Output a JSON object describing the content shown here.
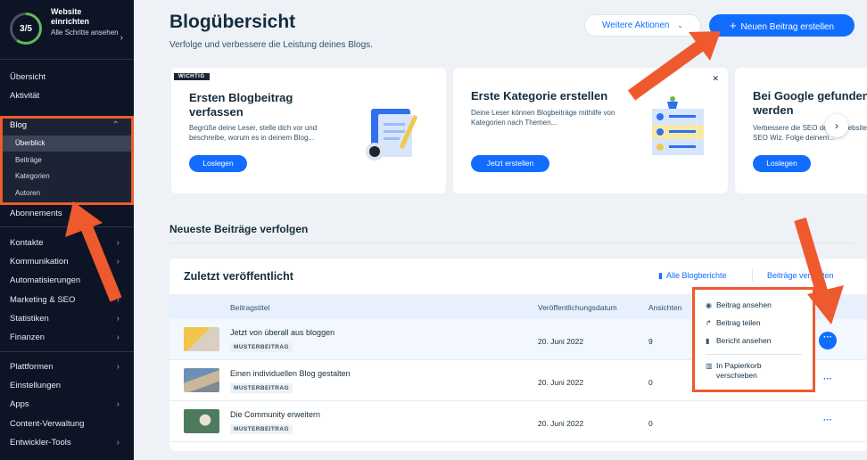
{
  "sidebar": {
    "setup": {
      "progress_label": "3/5",
      "progress": 0.6,
      "title": "Website einrichten",
      "subtitle": "Alle Schritte ansehen"
    },
    "items_top": [
      "Übersicht",
      "Aktivität"
    ],
    "blog": {
      "label": "Blog",
      "sub": [
        "Überblick",
        "Beiträge",
        "Kategorien",
        "Autoren"
      ],
      "active": "Überblick"
    },
    "items_mid": [
      "Abonnements",
      "Kontakte",
      "Kommunikation",
      "Automatisierungen",
      "Marketing & SEO",
      "Statistiken",
      "Finanzen"
    ],
    "items_bottom": [
      "Plattformen",
      "Einstellungen",
      "Apps",
      "Content-Verwaltung",
      "Entwickler-Tools"
    ]
  },
  "header": {
    "title": "Blogübersicht",
    "subtitle": "Verfolge und verbessere die Leistung deines Blogs.",
    "more_actions": "Weitere Aktionen",
    "new_post": "Neuen Beitrag erstellen"
  },
  "cards": [
    {
      "badge": "WICHTIG",
      "title": "Ersten Blogbeitrag verfassen",
      "text": "Begrüße deine Leser, stelle dich vor und beschreibe, worum es in deinem Blog...",
      "button": "Loslegen"
    },
    {
      "title": "Erste Kategorie erstellen",
      "text": "Deine Leser können Blogbeiträge mithilfe von Kategorien nach Themen...",
      "button": "Jetzt erstellen"
    },
    {
      "title": "Bei Google gefunden werden",
      "text": "Verbessere die SEO deiner Website mit dem SEO Wiz. Folge deinem...",
      "button": "Loslegen"
    }
  ],
  "section_title": "Neueste Beiträge verfolgen",
  "panel": {
    "title": "Zuletzt veröffentlicht",
    "link_all": "Alle Blogberichte",
    "link_manage": "Beiträge verwalten",
    "columns": [
      "Beitragstitel",
      "Veröffentlichungsdatum",
      "Ansichten"
    ],
    "rows": [
      {
        "title": "Jetzt von überall aus bloggen",
        "badge": "MUSTERBEITRAG",
        "date": "20. Juni 2022",
        "views": "9"
      },
      {
        "title": "Einen individuellen Blog gestalten",
        "badge": "MUSTERBEITRAG",
        "date": "20. Juni 2022",
        "views": "0"
      },
      {
        "title": "Die Community erweitern",
        "badge": "MUSTERBEITRAG",
        "date": "20. Juni 2022",
        "views": "0"
      }
    ]
  },
  "menu": {
    "items": [
      "Beitrag ansehen",
      "Beitrag teilen",
      "Bericht ansehen"
    ],
    "delete": "In Papierkorb verschieben"
  },
  "colors": {
    "accent": "#116dff",
    "annotation": "#ee5a2e",
    "sidebar": "#0c1426",
    "progress": "#60bc57"
  }
}
